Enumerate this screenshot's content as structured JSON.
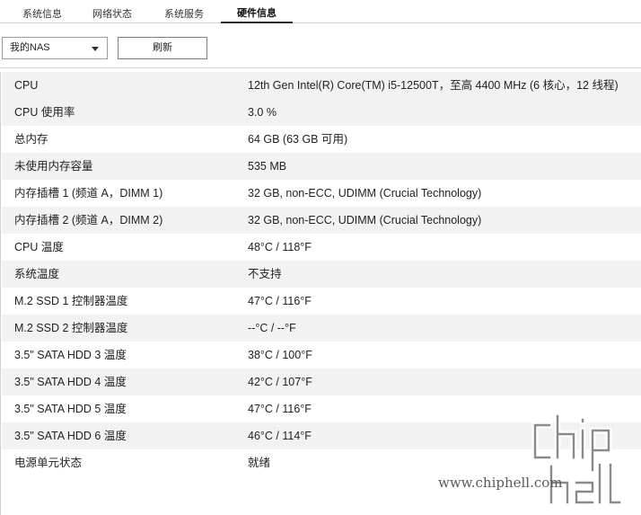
{
  "tabs": [
    {
      "label": "系统信息",
      "active": false
    },
    {
      "label": "网络状态",
      "active": false
    },
    {
      "label": "系统服务",
      "active": false
    },
    {
      "label": "硬件信息",
      "active": true
    }
  ],
  "toolbar": {
    "device_select_value": "我的NAS",
    "refresh_label": "刷新"
  },
  "hardware_rows": [
    {
      "key": "CPU",
      "value": "12th Gen Intel(R) Core(TM) i5-12500T，至高 4400 MHz (6 核心，12 线程)"
    },
    {
      "key": "CPU 使用率",
      "value": "3.0 %"
    },
    {
      "key": "总内存",
      "value": "64 GB (63 GB 可用)"
    },
    {
      "key": "未使用内存容量",
      "value": "535 MB"
    },
    {
      "key": "内存插槽 1 (频道 A，DIMM 1)",
      "value": "32 GB, non-ECC, UDIMM (Crucial Technology)"
    },
    {
      "key": "内存插槽 2 (频道 A，DIMM 2)",
      "value": "32 GB, non-ECC, UDIMM (Crucial Technology)"
    },
    {
      "key": "CPU 温度",
      "value": "48°C / 118°F"
    },
    {
      "key": "系统温度",
      "value": "不支持"
    },
    {
      "key": "M.2 SSD 1 控制器温度",
      "value": "47°C / 116°F"
    },
    {
      "key": "M.2 SSD 2 控制器温度",
      "value": "--°C / --°F"
    },
    {
      "key": "3.5\" SATA HDD 3 温度",
      "value": "38°C / 100°F"
    },
    {
      "key": "3.5\" SATA HDD 4 温度",
      "value": "42°C / 107°F"
    },
    {
      "key": "3.5\" SATA HDD 5 温度",
      "value": "47°C / 116°F"
    },
    {
      "key": "3.5\" SATA HDD 6 温度",
      "value": "46°C / 114°F"
    },
    {
      "key": "电源单元状态",
      "value": "就绪"
    }
  ],
  "watermark": {
    "text": "www.chiphell.com",
    "logo_text": "chip hell"
  }
}
